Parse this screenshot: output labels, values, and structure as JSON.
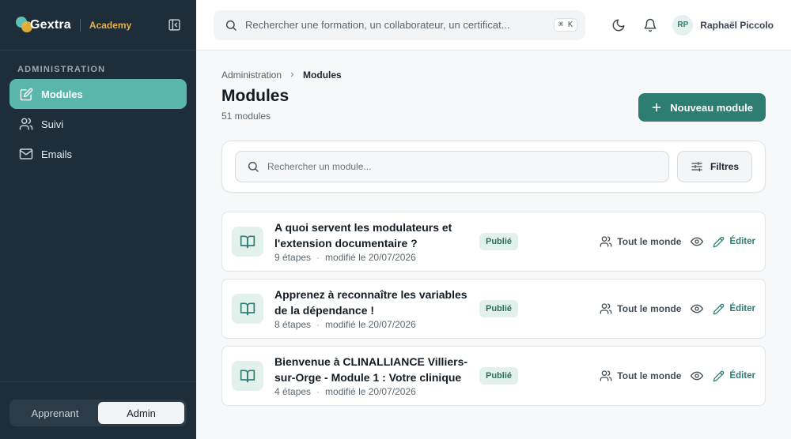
{
  "brand": {
    "name": "Gextra",
    "product": "Academy"
  },
  "sidebar": {
    "section_title": "ADMINISTRATION",
    "items": [
      {
        "label": "Modules",
        "icon": "edit-square-icon",
        "active": true
      },
      {
        "label": "Suivi",
        "icon": "users-icon",
        "active": false
      },
      {
        "label": "Emails",
        "icon": "mail-icon",
        "active": false
      }
    ],
    "mode_toggle": {
      "learner": "Apprenant",
      "admin": "Admin",
      "selected": "Admin"
    }
  },
  "topbar": {
    "search_placeholder": "Rechercher une formation, un collaborateur, un certificat...",
    "shortcut": "⌘ K",
    "user": {
      "initials": "RP",
      "name": "Raphaël Piccolo"
    }
  },
  "breadcrumb": {
    "parent": "Administration",
    "current": "Modules"
  },
  "page": {
    "title": "Modules",
    "count": "51 modules",
    "new_button": "Nouveau module",
    "search_placeholder": "Rechercher un module...",
    "filters_label": "Filtres"
  },
  "modules": [
    {
      "title": "A quoi servent les modulateurs et l'extension documentaire ?",
      "steps": "9 étapes",
      "modified": "modifié le 20/07/2026",
      "status": "Publié",
      "audience": "Tout le monde",
      "edit_label": "Éditer"
    },
    {
      "title": "Apprenez à reconnaître les variables de la dépendance !",
      "steps": "8 étapes",
      "modified": "modifié le 20/07/2026",
      "status": "Publié",
      "audience": "Tout le monde",
      "edit_label": "Éditer"
    },
    {
      "title": "Bienvenue à CLINALLIANCE Villiers-sur-Orge - Module 1 : Votre clinique",
      "steps": "4 étapes",
      "modified": "modifié le 20/07/2026",
      "status": "Publié",
      "audience": "Tout le monde",
      "edit_label": "Éditer"
    }
  ],
  "colors": {
    "sidebar_bg": "#1e2d3a",
    "accent": "#5ab5ab",
    "primary": "#2e7d72",
    "brand_gold": "#e3b24a",
    "badge_bg": "#e3f1ec"
  }
}
